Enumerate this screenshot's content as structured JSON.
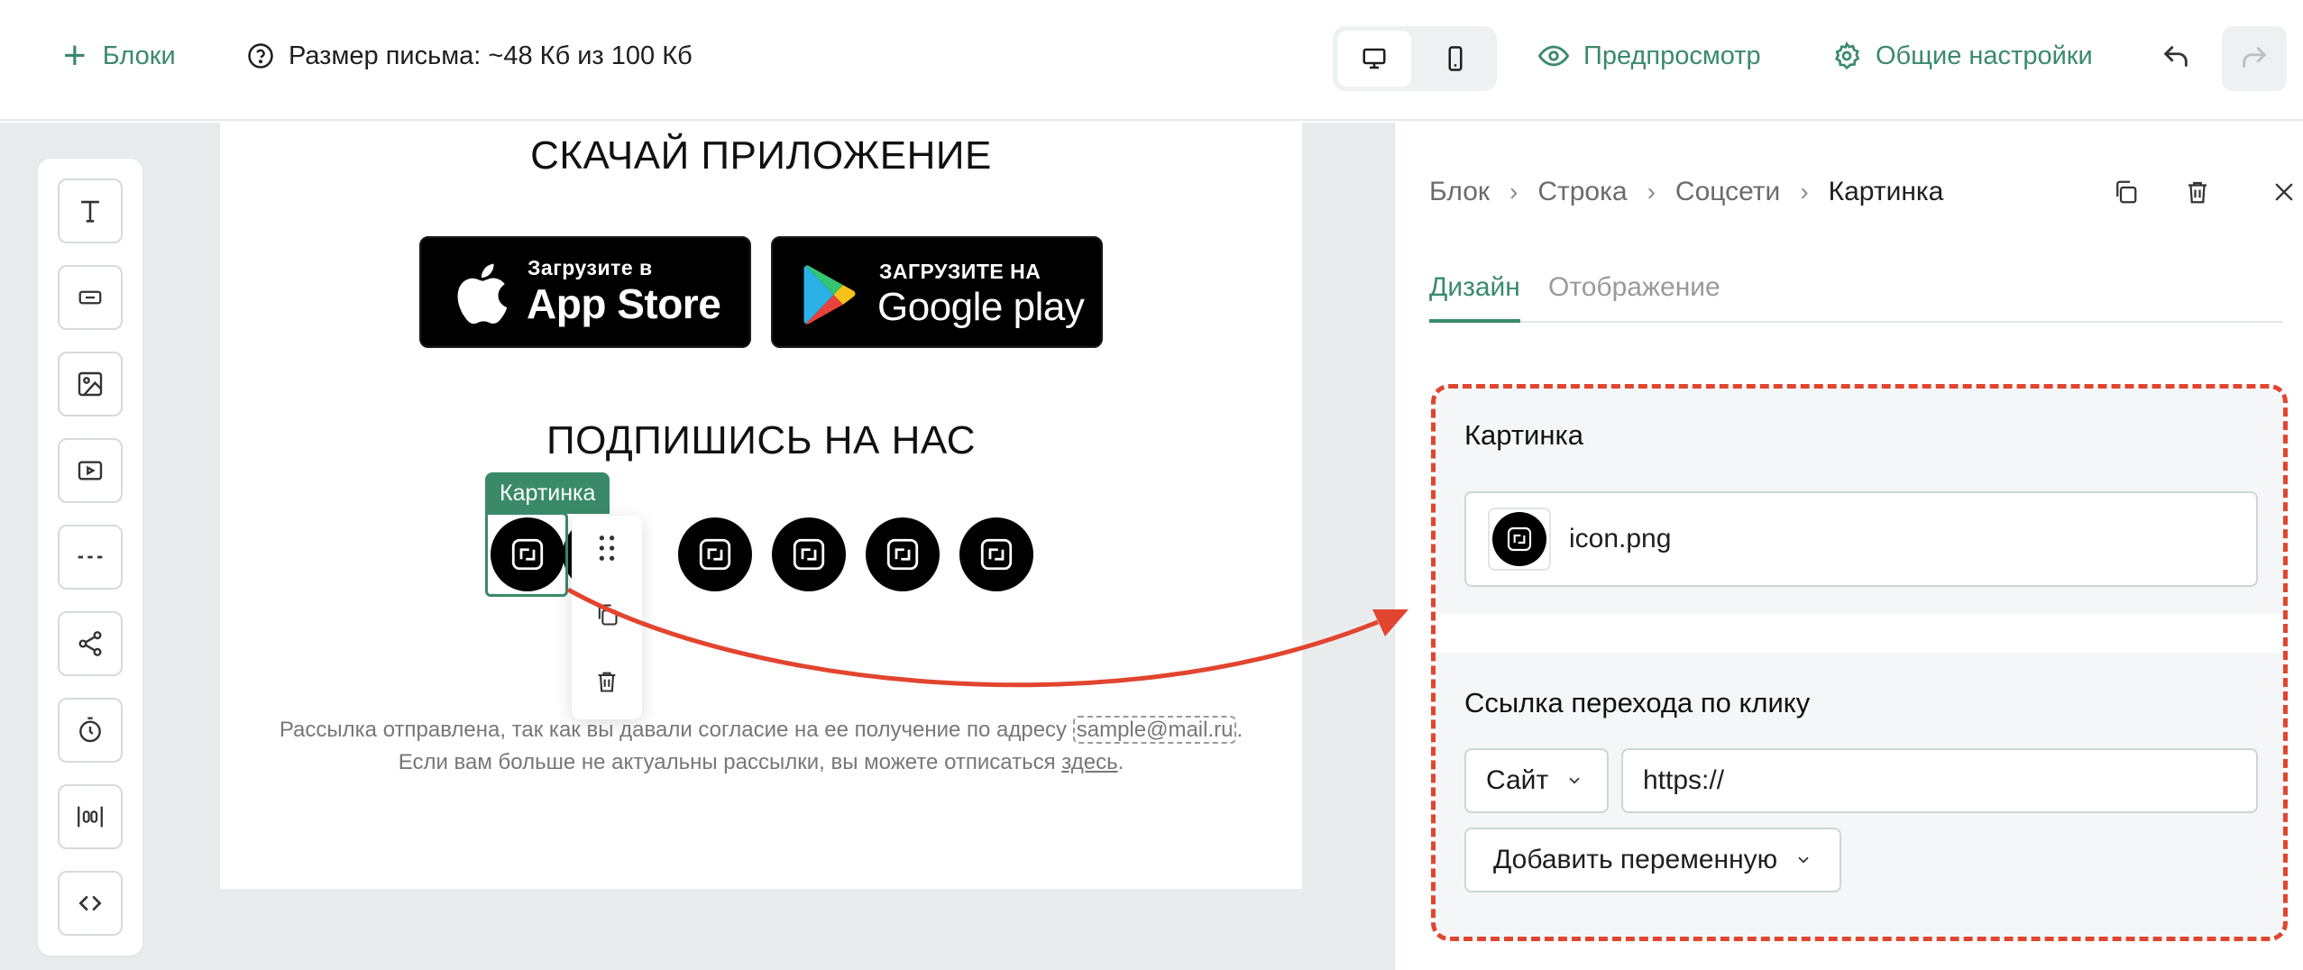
{
  "topbar": {
    "blocks_label": "Блоки",
    "size_label": "Размер письма: ~48 Кб из 100 Кб",
    "preview_label": "Предпросмотр",
    "settings_label": "Общие настройки"
  },
  "email": {
    "heading_app": "СКАЧАЙ ПРИЛОЖЕНИЕ",
    "appstore_small": "Загрузите в",
    "appstore_big": "App Store",
    "gplay_small": "ЗАГРУЗИТЕ НА",
    "gplay_big": "Google play",
    "heading_subscribe": "ПОДПИШИСЬ НА НАС",
    "selection_label": "Картинка",
    "footer_line1_before": "Рассылка отправлена, так как вы давали согласие на ее получение по адресу ",
    "footer_email": "sample@mail.ru",
    "footer_line1_after": ".",
    "footer_line2_before": "Если вам больше не актуальны рассылки, вы можете отписаться ",
    "footer_link": "здесь",
    "footer_line2_after": "."
  },
  "panel": {
    "breadcrumbs": [
      "Блок",
      "Строка",
      "Соцсети",
      "Картинка"
    ],
    "tabs": {
      "design": "Дизайн",
      "display": "Отображение"
    },
    "image_section": {
      "title": "Картинка",
      "file_name": "icon.png"
    },
    "link_section": {
      "title": "Ссылка перехода по клику",
      "type_selected": "Сайт",
      "url_value": "https://",
      "add_variable_label": "Добавить переменную"
    }
  },
  "colors": {
    "accent": "#3a8a6a",
    "annotation": "#e2452f",
    "canvas_bg": "#e9eced"
  }
}
